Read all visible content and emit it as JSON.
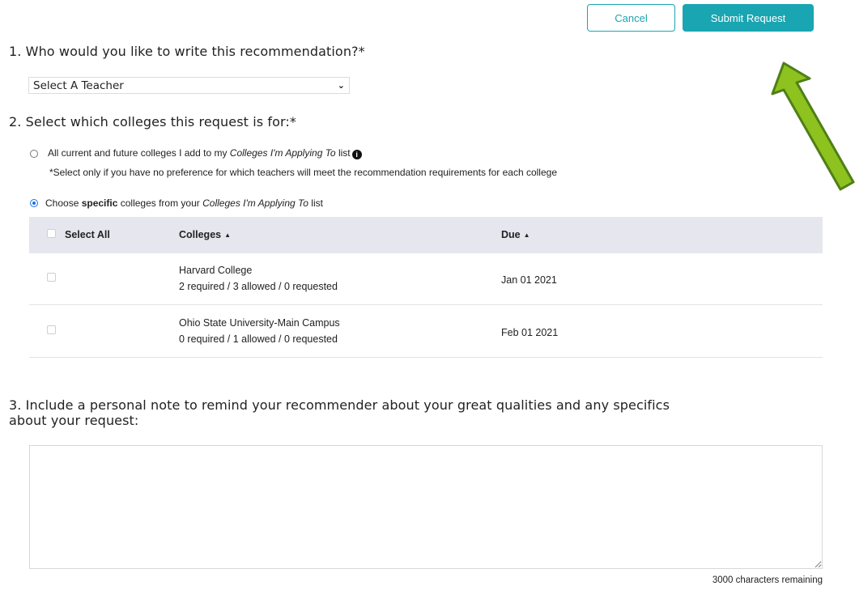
{
  "actions": {
    "cancel_label": "Cancel",
    "submit_label": "Submit Request"
  },
  "q1": {
    "label": "1. Who would you like to write this recommendation?*",
    "select_value": "Select A Teacher"
  },
  "q2": {
    "label": "2. Select which colleges this request is for:*",
    "option_all_prefix": "All current and future colleges I add to my ",
    "option_all_list": "Colleges I'm Applying To",
    "option_all_suffix": " list",
    "option_all_note": "*Select only if you have no preference for which teachers will meet the recommendation requirements for each college",
    "option_specific_prefix": "Choose ",
    "option_specific_bold": "specific",
    "option_specific_mid": " colleges from your ",
    "option_specific_list": "Colleges I'm Applying To",
    "option_specific_suffix": " list",
    "selected_option": "specific"
  },
  "table": {
    "headers": {
      "select_all": "Select All",
      "colleges": "Colleges",
      "due": "Due"
    },
    "sort_glyph": "▲",
    "rows": [
      {
        "college": "Harvard College",
        "counts": "2 required / 3 allowed / 0 requested",
        "due": "Jan 01 2021"
      },
      {
        "college": "Ohio State University-Main Campus",
        "counts": "0 required / 1 allowed / 0 requested",
        "due": "Feb 01 2021"
      }
    ]
  },
  "q3": {
    "label_line1": "3. Include a personal note to remind your recommender about your great qualities and any specifics",
    "label_line2": "about your request:",
    "note_value": "",
    "remaining": "3000 characters remaining"
  },
  "colors": {
    "accent": "#19a5b1",
    "arrow_fill": "#8dc21f",
    "arrow_stroke": "#4f7f16",
    "header_bg": "#e6e6ee"
  },
  "icons": {
    "info": "info-icon",
    "dropdown": "chevron-down-icon",
    "annotation": "arrow-pointer-icon"
  }
}
